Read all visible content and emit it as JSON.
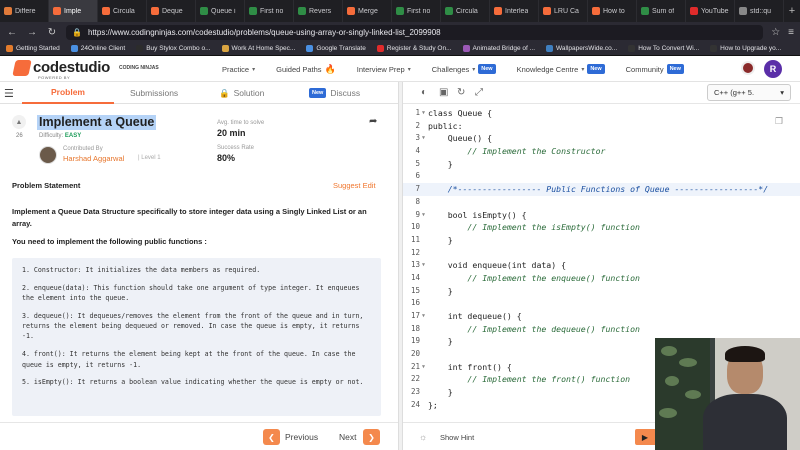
{
  "browser": {
    "tabs": [
      {
        "label": "Differe",
        "color": "#e07a3a",
        "active": false
      },
      {
        "label": "Imple",
        "color": "#f66c3b",
        "active": true
      },
      {
        "label": "Circula",
        "color": "#f66c3b",
        "active": false
      },
      {
        "label": "Deque",
        "color": "#f66c3b",
        "active": false
      },
      {
        "label": "Queue i",
        "color": "#2f8d46",
        "active": false
      },
      {
        "label": "First no",
        "color": "#2f8d46",
        "active": false
      },
      {
        "label": "Revers",
        "color": "#2f8d46",
        "active": false
      },
      {
        "label": "Merge",
        "color": "#f66c3b",
        "active": false
      },
      {
        "label": "First no",
        "color": "#2f8d46",
        "active": false
      },
      {
        "label": "Circula",
        "color": "#2f8d46",
        "active": false
      },
      {
        "label": "Interlea",
        "color": "#f66c3b",
        "active": false
      },
      {
        "label": "LRU Ca",
        "color": "#f66c3b",
        "active": false
      },
      {
        "label": "How to",
        "color": "#f66c3b",
        "active": false
      },
      {
        "label": "Sum of",
        "color": "#2f8d46",
        "active": false
      },
      {
        "label": "YouTube",
        "color": "#e02b2b",
        "active": false
      },
      {
        "label": "std::qu",
        "color": "#888888",
        "active": false
      }
    ],
    "url": "https://www.codingninjas.com/codestudio/problems/queue-using-array-or-singly-linked-list_2099908",
    "bookmarks": [
      {
        "label": "Getting Started",
        "color": "#e27b2c"
      },
      {
        "label": "24Online Client",
        "color": "#4a90e2"
      },
      {
        "label": "Buy Stylox Combo o...",
        "color": "#2c2c2c"
      },
      {
        "label": "Work At Home Spec...",
        "color": "#d9a441"
      },
      {
        "label": "Google Translate",
        "color": "#4a90e2"
      },
      {
        "label": "Register & Study On...",
        "color": "#e02b2b"
      },
      {
        "label": "Animated Bridge of ...",
        "color": "#9b59b6"
      },
      {
        "label": "WallpapersWide.co...",
        "color": "#3f7fbf"
      },
      {
        "label": "How To Convert Wi...",
        "color": "#333333"
      },
      {
        "label": "How to Upgrade yo...",
        "color": "#333333"
      }
    ]
  },
  "site": {
    "logo_text": "codestudio",
    "logo_sub": "POWERED BY",
    "logo_brand": "CODING NINJAS",
    "menu": [
      {
        "label": "Practice",
        "caret": true,
        "badge": "",
        "flame": false
      },
      {
        "label": "Guided Paths",
        "caret": false,
        "badge": "",
        "flame": true
      },
      {
        "label": "Interview Prep",
        "caret": true,
        "badge": "",
        "flame": false
      },
      {
        "label": "Challenges",
        "caret": true,
        "badge": "New",
        "flame": false
      },
      {
        "label": "Knowledge Centre",
        "caret": true,
        "badge": "New",
        "flame": false
      },
      {
        "label": "Community",
        "caret": false,
        "badge": "New",
        "flame": false
      }
    ],
    "user_initial": "R"
  },
  "problem": {
    "tabs": {
      "problem": "Problem",
      "submissions": "Submissions",
      "solution": "Solution",
      "discuss_badge": "New",
      "discuss": "Discuss"
    },
    "upvotes": "26",
    "title": "Implement a Queue",
    "difficulty_label": "Difficulty:",
    "difficulty": "EASY",
    "contributed_by": "Contributed By",
    "author": "Harshad Aggarwal",
    "author_level": "| Level 1",
    "avg_time_label": "Avg. time to solve",
    "avg_time": "20 min",
    "success_label": "Success Rate",
    "success_rate": "80%",
    "statement_title": "Problem Statement",
    "suggest_edit": "Suggest Edit",
    "intro": "Implement a Queue Data Structure specifically to store integer data using a Singly Linked List or an array.",
    "intro2": "You need to implement the following public functions :",
    "functions": [
      "1. Constructor: It initializes the data members as required.",
      "2. enqueue(data): This function should take one argument of type integer. It enqueues the element into the queue.",
      "3. dequeue(): It dequeues/removes the element from the front of the queue and in turn, returns the element being dequeued or removed. In case the queue is empty, it returns -1.",
      "4. front(): It returns the element being kept at the front of the queue. In case the queue is empty, it returns -1.",
      "5. isEmpty(): It returns a boolean value indicating whether the queue is empty or not."
    ],
    "previous": "Previous",
    "next": "Next"
  },
  "editor": {
    "language": "C++ (g++ 5.",
    "show_hint": "Show Hint",
    "lines": [
      {
        "n": "1",
        "text": "class Queue {",
        "type": "code",
        "fold": true
      },
      {
        "n": "2",
        "text": "public:",
        "type": "code",
        "fold": false
      },
      {
        "n": "3",
        "text": "    Queue() {",
        "type": "code",
        "fold": true
      },
      {
        "n": "4",
        "text": "        // Implement the Constructor",
        "type": "comment",
        "fold": false
      },
      {
        "n": "5",
        "text": "    }",
        "type": "code",
        "fold": false
      },
      {
        "n": "6",
        "text": "",
        "type": "code",
        "fold": false
      },
      {
        "n": "7",
        "text": "    /*----------------- Public Functions of Queue -----------------*/",
        "type": "comment-blue",
        "fold": false
      },
      {
        "n": "8",
        "text": "",
        "type": "code",
        "fold": false
      },
      {
        "n": "9",
        "text": "    bool isEmpty() {",
        "type": "code",
        "fold": true
      },
      {
        "n": "10",
        "text": "        // Implement the isEmpty() function",
        "type": "comment",
        "fold": false
      },
      {
        "n": "11",
        "text": "    }",
        "type": "code",
        "fold": false
      },
      {
        "n": "12",
        "text": "",
        "type": "code",
        "fold": false
      },
      {
        "n": "13",
        "text": "    void enqueue(int data) {",
        "type": "code",
        "fold": true
      },
      {
        "n": "14",
        "text": "        // Implement the enqueue() function",
        "type": "comment",
        "fold": false
      },
      {
        "n": "15",
        "text": "    }",
        "type": "code",
        "fold": false
      },
      {
        "n": "16",
        "text": "",
        "type": "code",
        "fold": false
      },
      {
        "n": "17",
        "text": "    int dequeue() {",
        "type": "code",
        "fold": true
      },
      {
        "n": "18",
        "text": "        // Implement the dequeue() function",
        "type": "comment",
        "fold": false
      },
      {
        "n": "19",
        "text": "    }",
        "type": "code",
        "fold": false
      },
      {
        "n": "20",
        "text": "",
        "type": "code",
        "fold": false
      },
      {
        "n": "21",
        "text": "    int front() {",
        "type": "code",
        "fold": true
      },
      {
        "n": "22",
        "text": "        // Implement the front() function",
        "type": "comment",
        "fold": false
      },
      {
        "n": "23",
        "text": "    }",
        "type": "code",
        "fold": false
      },
      {
        "n": "24",
        "text": "};",
        "type": "code",
        "fold": false
      }
    ]
  }
}
